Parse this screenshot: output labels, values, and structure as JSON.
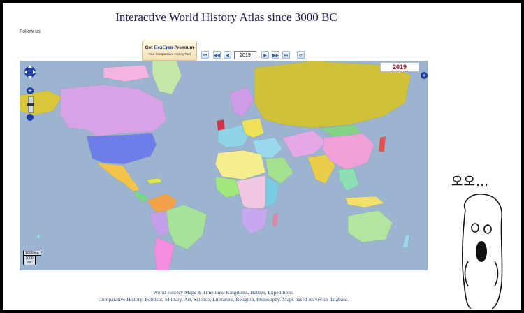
{
  "header": {
    "title": "Interactive World History Atlas since 3000 BC",
    "follow_us": "Follow us"
  },
  "promo": {
    "get": "Get",
    "brand": "GeaCron",
    "premium": "Premium",
    "tagline": "Your Comparative History Tool"
  },
  "timeline": {
    "year_value": "2019",
    "buttons": [
      "first",
      "back-100",
      "back-1",
      "forward-1",
      "forward-100",
      "last",
      "refresh"
    ]
  },
  "map": {
    "year_label": "2019",
    "scale_km": "2000 km",
    "scale_mi": "1000 mi",
    "zoom_in": "+",
    "zoom_out": "−",
    "layer_switch": "+"
  },
  "footer": {
    "line1": "World History Maps & Timelines. Kingdoms, Battles, Expeditions.",
    "line2": "Comparative History, Political, Military, Art, Science, Literature, Religion, Philosophy. Maps based on vector database."
  },
  "doodle": {
    "text": "오오…"
  },
  "colors": {
    "ocean": "#9cb4cf",
    "year_badge": "#a0182c",
    "control_blue": "#1e40a0"
  }
}
